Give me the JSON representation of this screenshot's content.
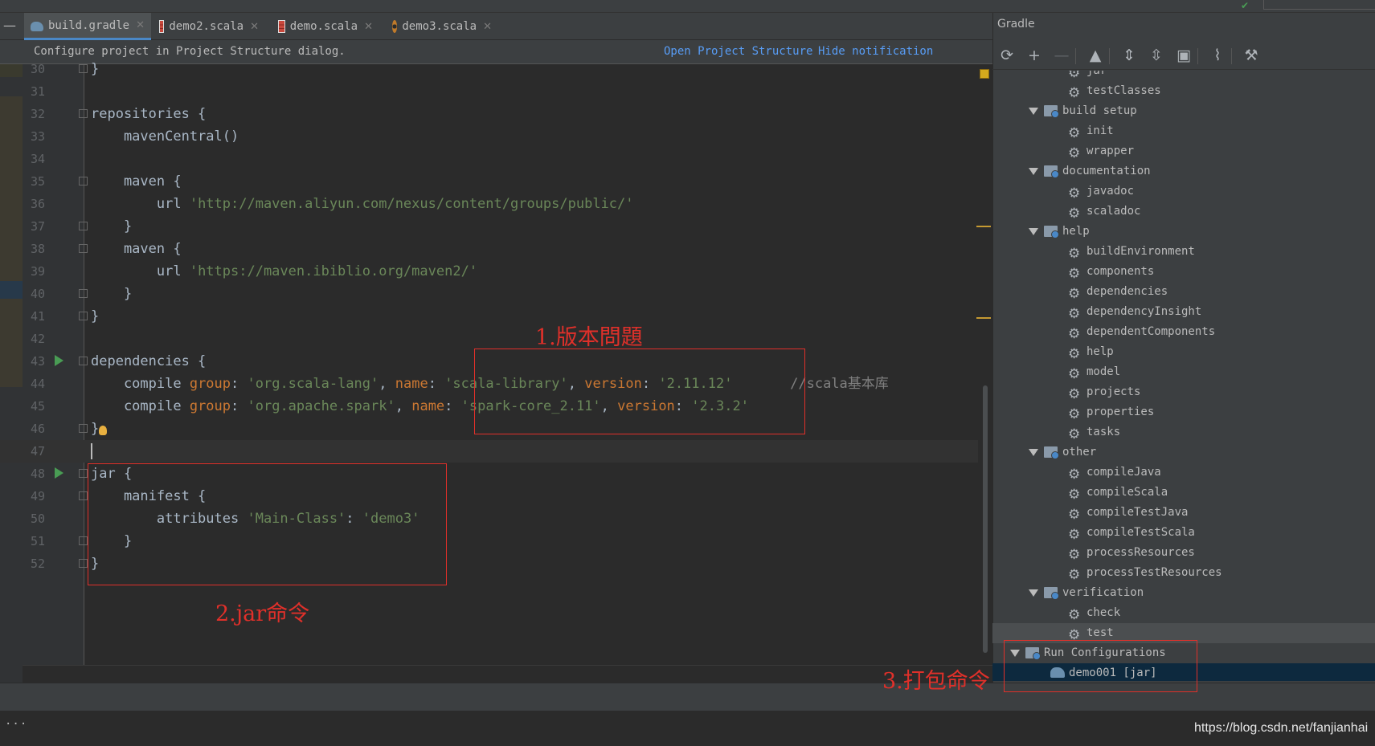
{
  "tabs": [
    {
      "label": "build.gradle",
      "icon": "gradle-icon",
      "active": true
    },
    {
      "label": "demo2.scala",
      "icon": "scala-file-icon"
    },
    {
      "label": "demo.scala",
      "icon": "scala-file-icon"
    },
    {
      "label": "demo3.scala",
      "icon": "scala-object-icon"
    }
  ],
  "notification": {
    "message": "Configure project in Project Structure dialog.",
    "open_link": "Open Project Structure",
    "hide_link": "Hide notification"
  },
  "editor": {
    "lines": [
      {
        "num": "30",
        "text": "}"
      },
      {
        "num": "31",
        "text": ""
      },
      {
        "num": "32",
        "text": "repositories {"
      },
      {
        "num": "33",
        "text": "    mavenCentral()"
      },
      {
        "num": "34",
        "text": ""
      },
      {
        "num": "35",
        "text": "    maven {"
      },
      {
        "num": "36",
        "text": "        url 'http://maven.aliyun.com/nexus/content/groups/public/'"
      },
      {
        "num": "37",
        "text": "    }"
      },
      {
        "num": "38",
        "text": "    maven {"
      },
      {
        "num": "39",
        "text": "        url 'https://maven.ibiblio.org/maven2/'"
      },
      {
        "num": "40",
        "text": "    }"
      },
      {
        "num": "41",
        "text": "}"
      },
      {
        "num": "42",
        "text": ""
      },
      {
        "num": "43",
        "text": "dependencies {"
      },
      {
        "num": "44",
        "text": "    compile group: 'org.scala-lang', name: 'scala-library', version: '2.11.12'       //scala基本库"
      },
      {
        "num": "45",
        "text": "    compile group: 'org.apache.spark', name: 'spark-core_2.11', version: '2.3.2'"
      },
      {
        "num": "46",
        "text": "}"
      },
      {
        "num": "47",
        "text": ""
      },
      {
        "num": "48",
        "text": "jar {"
      },
      {
        "num": "49",
        "text": "    manifest {"
      },
      {
        "num": "50",
        "text": "        attributes 'Main-Class': 'demo3'"
      },
      {
        "num": "51",
        "text": "    }"
      },
      {
        "num": "52",
        "text": "}"
      }
    ]
  },
  "gradle_panel": {
    "title": "Gradle",
    "toolbar": [
      "refresh-icon",
      "add-icon",
      "remove-icon",
      "gradle-elephant-icon",
      "expand-all-icon",
      "collapse-all-icon",
      "folder-icon",
      "toggle-offline-icon",
      "wrench-icon"
    ],
    "tree": [
      {
        "label": "jar",
        "type": "task",
        "level": 2
      },
      {
        "label": "testClasses",
        "type": "task",
        "level": 2
      },
      {
        "label": "build setup",
        "type": "group",
        "level": 1
      },
      {
        "label": "init",
        "type": "task",
        "level": 2
      },
      {
        "label": "wrapper",
        "type": "task",
        "level": 2
      },
      {
        "label": "documentation",
        "type": "group",
        "level": 1
      },
      {
        "label": "javadoc",
        "type": "task",
        "level": 2
      },
      {
        "label": "scaladoc",
        "type": "task",
        "level": 2
      },
      {
        "label": "help",
        "type": "group",
        "level": 1
      },
      {
        "label": "buildEnvironment",
        "type": "task",
        "level": 2
      },
      {
        "label": "components",
        "type": "task",
        "level": 2
      },
      {
        "label": "dependencies",
        "type": "task",
        "level": 2
      },
      {
        "label": "dependencyInsight",
        "type": "task",
        "level": 2
      },
      {
        "label": "dependentComponents",
        "type": "task",
        "level": 2
      },
      {
        "label": "help",
        "type": "task",
        "level": 2
      },
      {
        "label": "model",
        "type": "task",
        "level": 2
      },
      {
        "label": "projects",
        "type": "task",
        "level": 2
      },
      {
        "label": "properties",
        "type": "task",
        "level": 2
      },
      {
        "label": "tasks",
        "type": "task",
        "level": 2
      },
      {
        "label": "other",
        "type": "group",
        "level": 1
      },
      {
        "label": "compileJava",
        "type": "task",
        "level": 2
      },
      {
        "label": "compileScala",
        "type": "task",
        "level": 2
      },
      {
        "label": "compileTestJava",
        "type": "task",
        "level": 2
      },
      {
        "label": "compileTestScala",
        "type": "task",
        "level": 2
      },
      {
        "label": "processResources",
        "type": "task",
        "level": 2
      },
      {
        "label": "processTestResources",
        "type": "task",
        "level": 2
      },
      {
        "label": "verification",
        "type": "group",
        "level": 1
      },
      {
        "label": "check",
        "type": "task",
        "level": 2
      },
      {
        "label": "test",
        "type": "task",
        "level": 2
      },
      {
        "label": "Run Configurations",
        "type": "group",
        "level": 0
      },
      {
        "label": "demo001 [jar]",
        "type": "runconfig",
        "level": 1
      }
    ]
  },
  "annotations": {
    "version_issue": "1.版本問題",
    "jar_command": "2.jar命令",
    "package_command": "3.打包命令"
  },
  "status": {
    "dots": "...",
    "watermark": "https://blog.csdn.net/fanjianhai"
  },
  "colors": {
    "accent": "#4a88c7",
    "annotation_red": "#e0302a",
    "link": "#589df6"
  }
}
